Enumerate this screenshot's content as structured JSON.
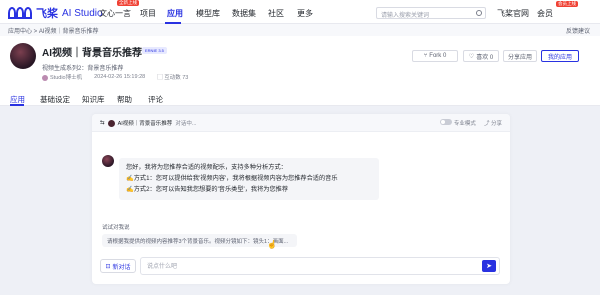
{
  "topnav": {
    "logo_text": "飞桨",
    "logo_sub": "AI Studio",
    "items": [
      {
        "label": "文心一言",
        "badge": "全新上线"
      },
      {
        "label": "项目",
        "badge": ""
      },
      {
        "label": "应用",
        "badge": ""
      },
      {
        "label": "模型库",
        "badge": ""
      },
      {
        "label": "数据集",
        "badge": ""
      },
      {
        "label": "社区",
        "badge": ""
      },
      {
        "label": "更多",
        "badge": ""
      }
    ],
    "search_placeholder": "请输入搜索关键词",
    "official_site": "飞桨官网",
    "member": "会员",
    "member_badge": "会员上线"
  },
  "breadcrumb": {
    "path": "应用中心  >  AI视频｜背景音乐推荐",
    "feedback": "反馈建议"
  },
  "app": {
    "title": "AI视频｜背景音乐推荐",
    "model_tag": "ERNIE 3.5",
    "subtitle": "视频生成系列2：背景音乐推荐",
    "author": "Studio博士机",
    "date": "2024-02-26 15:19:28",
    "interactions": "互动数 73",
    "buttons": {
      "fork": "Fork  0",
      "like": "喜欢  0",
      "share": "分享应用",
      "my_apps": "我的应用"
    }
  },
  "tabs": [
    "应用",
    "基础设定",
    "知识库",
    "帮助",
    "评论"
  ],
  "chat": {
    "header_title": "AI视频｜背景音乐推荐",
    "header_sub": "对话中...",
    "pro_mode": "专业模式",
    "share": "分享",
    "bubble_lines": [
      "您好，我将为您推荐合适的视频配乐，支持多种分析方式：",
      "方式1：您可以提供给我'视频内容'，我将根据视频内容为您推荐合适的音乐",
      "方式2：您可以告知我您想要的'音乐类型'，我将为您推荐"
    ],
    "try_label": "试试对我说",
    "suggestion": "请根据我提供的视频内容推荐3个背景音乐。视频分镜如下：镜头1：画面...",
    "new_chat": "新对话",
    "input_placeholder": "说点什么吧"
  }
}
